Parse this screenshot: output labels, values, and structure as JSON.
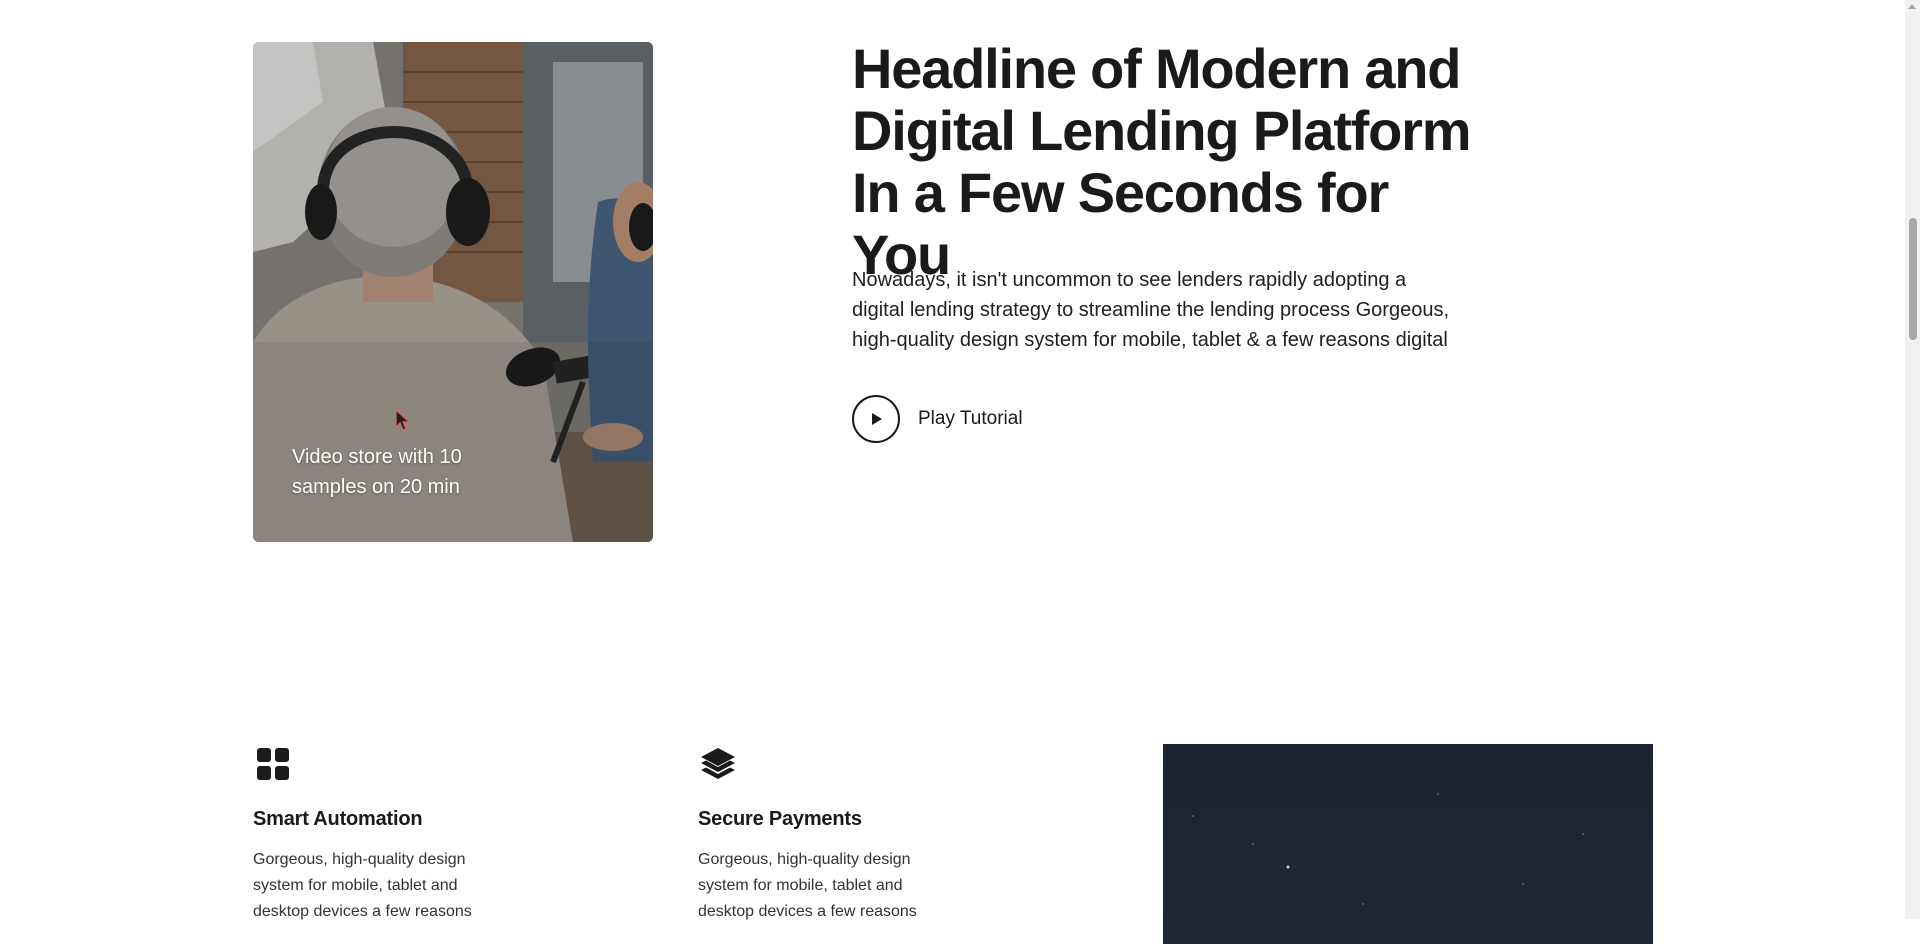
{
  "video_card": {
    "caption": "Video store with 10 samples on 20 min"
  },
  "hero": {
    "headline": "Headline of Modern and Digital Lending Platform In a Few Seconds for You",
    "lead": "Nowadays, it isn't uncommon to see lenders rapidly adopting a digital lending strategy to streamline the lending process Gorgeous, high-quality design system for mobile, tablet & a few reasons digital",
    "play_label": "Play Tutorial"
  },
  "features": [
    {
      "icon": "grid-icon",
      "title": "Smart Automation",
      "text": "Gorgeous, high-quality design system for mobile, tablet and desktop devices a few reasons"
    },
    {
      "icon": "layers-icon",
      "title": "Secure Payments",
      "text": "Gorgeous, high-quality design system for mobile, tablet and desktop devices a few reasons"
    }
  ],
  "colors": {
    "text": "#1a1a1a",
    "body_text": "#333333",
    "night_bg": "#1b2230"
  }
}
